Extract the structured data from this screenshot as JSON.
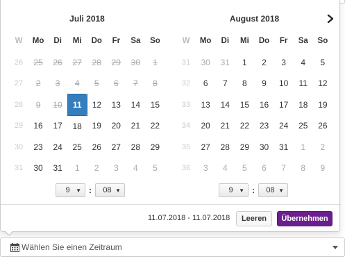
{
  "top_field": {
    "text": ""
  },
  "picker": {
    "left_month": {
      "title": "Juli 2018",
      "headers": [
        "W",
        "Mo",
        "Di",
        "Mi",
        "Do",
        "Fr",
        "Sa",
        "So"
      ],
      "rows": [
        [
          "26",
          "25",
          "26",
          "27",
          "28",
          "29",
          "30",
          "1"
        ],
        [
          "27",
          "2",
          "3",
          "4",
          "5",
          "6",
          "7",
          "8"
        ],
        [
          "28",
          "9",
          "10",
          "11",
          "12",
          "13",
          "14",
          "15"
        ],
        [
          "29",
          "16",
          "17",
          "18",
          "19",
          "20",
          "21",
          "22"
        ],
        [
          "30",
          "23",
          "24",
          "25",
          "26",
          "27",
          "28",
          "29"
        ],
        [
          "31",
          "30",
          "31",
          "1",
          "2",
          "3",
          "4",
          "5"
        ]
      ],
      "hour": "9",
      "minute": "08"
    },
    "right_month": {
      "title": "August 2018",
      "headers": [
        "W",
        "Mo",
        "Di",
        "Mi",
        "Do",
        "Fr",
        "Sa",
        "So"
      ],
      "rows": [
        [
          "31",
          "30",
          "31",
          "1",
          "2",
          "3",
          "4",
          "5"
        ],
        [
          "32",
          "6",
          "7",
          "8",
          "9",
          "10",
          "11",
          "12"
        ],
        [
          "33",
          "13",
          "14",
          "15",
          "16",
          "17",
          "18",
          "19"
        ],
        [
          "34",
          "20",
          "21",
          "22",
          "23",
          "24",
          "25",
          "26"
        ],
        [
          "35",
          "27",
          "28",
          "29",
          "30",
          "31",
          "1",
          "2"
        ],
        [
          "36",
          "3",
          "4",
          "5",
          "6",
          "7",
          "8",
          "9"
        ]
      ],
      "hour": "9",
      "minute": "08"
    },
    "time_separator": ":",
    "range_text": "11.07.2018 - 11.07.2018",
    "clear_label": "Leeren",
    "apply_label": "Übernehmen"
  },
  "range_input": {
    "placeholder": "Wählen Sie einen Zeitraum"
  },
  "colors": {
    "selected": "#357ebd",
    "apply_button": "#6b1f8c"
  },
  "icons": {
    "next": "chevron-right-icon",
    "calendar": "calendar-icon",
    "dropdown": "caret-down-icon"
  }
}
